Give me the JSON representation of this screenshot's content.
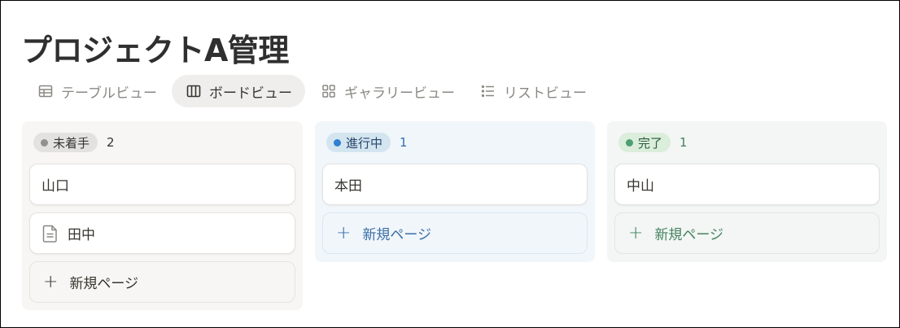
{
  "page": {
    "title": "プロジェクトA管理"
  },
  "tabs": [
    {
      "label": "テーブルビュー",
      "icon": "table-icon",
      "active": false
    },
    {
      "label": "ボードビュー",
      "icon": "board-icon",
      "active": true
    },
    {
      "label": "ギャラリービュー",
      "icon": "gallery-icon",
      "active": false
    },
    {
      "label": "リストビュー",
      "icon": "list-icon",
      "active": false
    }
  ],
  "columns": [
    {
      "status": "未着手",
      "count": "2",
      "colors": {
        "pill_bg": "#e3e2e0",
        "dot": "#91918e",
        "text": "#37352f",
        "count": "#37352f"
      },
      "cards": [
        {
          "title": "山口"
        },
        {
          "title": "田中",
          "icon": "document-icon"
        }
      ],
      "new_page_label": "新規ページ"
    },
    {
      "status": "進行中",
      "count": "1",
      "colors": {
        "pill_bg": "#d3e5ef",
        "dot": "#2f80d1",
        "text": "#28456c",
        "count": "#2f6fb0"
      },
      "cards": [
        {
          "title": "本田"
        }
      ],
      "new_page_label": "新規ページ"
    },
    {
      "status": "完了",
      "count": "1",
      "colors": {
        "pill_bg": "#dbeddb",
        "dot": "#4c9f70",
        "text": "#2b593f",
        "count": "#448361"
      },
      "cards": [
        {
          "title": "中山"
        }
      ],
      "new_page_label": "新規ページ"
    }
  ]
}
